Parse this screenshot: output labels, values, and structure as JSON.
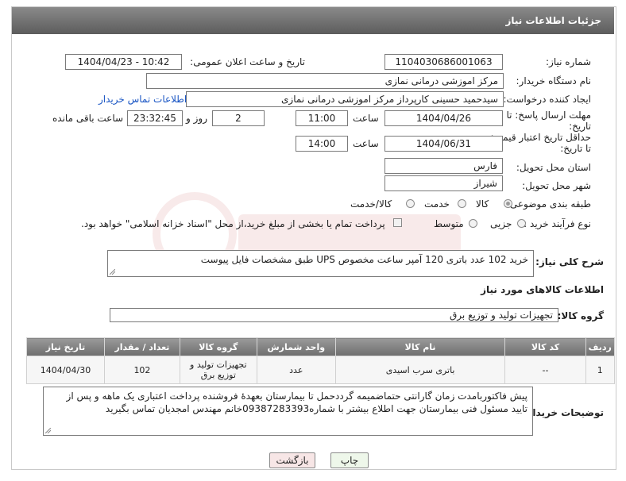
{
  "header": {
    "title": "جزئیات اطلاعات نیاز"
  },
  "form": {
    "need_number_label": "شماره نیاز:",
    "need_number": "1104030686001063",
    "announce_label": "تاریخ و ساعت اعلان عمومی:",
    "announce_value": "1404/04/23 - 10:42",
    "buyer_org_label": "نام دستگاه خریدار:",
    "buyer_org": "مرکز اموزشی درمانی نمازی",
    "requester_label": "ایجاد کننده درخواست:",
    "requester": "سیدحمید حسینی کارپرداز مرکز اموزشی درمانی نمازی",
    "buyer_contact_link": "اطلاعات تماس خریدار",
    "reply_deadline_label_1": "مهلت ارسال پاسخ: تا",
    "reply_deadline_label_2": "تاریخ:",
    "reply_date": "1404/04/26",
    "time_label": "ساعت",
    "reply_time": "11:00",
    "days_value": "2",
    "days_label": "روز و",
    "remaining_time": "23:32:45",
    "remaining_label": "ساعت باقی مانده",
    "price_valid_label_1": "حداقل تاریخ اعتبار قیمت:",
    "price_valid_label_2": "تا تاریخ:",
    "price_valid_date": "1404/06/31",
    "price_valid_time": "14:00",
    "province_label": "استان محل تحویل:",
    "province": "فارس",
    "city_label": "شهر محل تحویل:",
    "city": "شیراز",
    "category_label": "طبقه بندی موضوعی:",
    "category_options": [
      "کالا",
      "خدمت",
      "کالا/خدمت"
    ],
    "category_selected": "کالا",
    "process_label": "نوع فرآیند خرید :",
    "process_options": [
      "جزیی",
      "متوسط"
    ],
    "process_note": "پرداخت تمام یا بخشی از مبلغ خرید،از محل \"اسناد خزانه اسلامی\" خواهد بود.",
    "description_label": "شرح کلی نیاز:",
    "description": "خرید 102 عدد باتری 120 آمپر ساعت مخصوص UPS طبق مشخصات فایل پیوست"
  },
  "goods": {
    "section_title": "اطلاعات کالاهای مورد نیاز",
    "group_label": "گروه کالا:",
    "group_value": "تجهیزات تولید و توزیع برق",
    "table": {
      "headers": [
        "ردیف",
        "کد کالا",
        "نام کالا",
        "واحد شمارش",
        "گروه کالا",
        "تعداد / مقدار",
        "تاریخ نیاز"
      ],
      "rows": [
        [
          "1",
          "--",
          "باتری سرب اسیدی",
          "عدد",
          "تجهیزات تولید و توزیع برق",
          "102",
          "1404/04/30"
        ]
      ]
    }
  },
  "buyer_notes": {
    "label": "توضیحات خریدار:",
    "text": "پیش فاکتوربامدت زمان گارانتی حتماضمیمه گرددحمل تا بیمارستان بعهدهٔ فروشنده پرداخت اعتباری یک ماهه و پس از تایید مسئول فنی بیمارستان جهت اطلاع بیشتر با شماره09387283393خانم مهندس امجدیان تماس بگیرید"
  },
  "buttons": {
    "print": "چاپ",
    "back": "بازگشت"
  },
  "colors": {
    "header_bg": "#6e6e6e",
    "link": "#1a56c4",
    "print_btn": "#eef7ea",
    "back_btn": "#f7e6e6"
  }
}
